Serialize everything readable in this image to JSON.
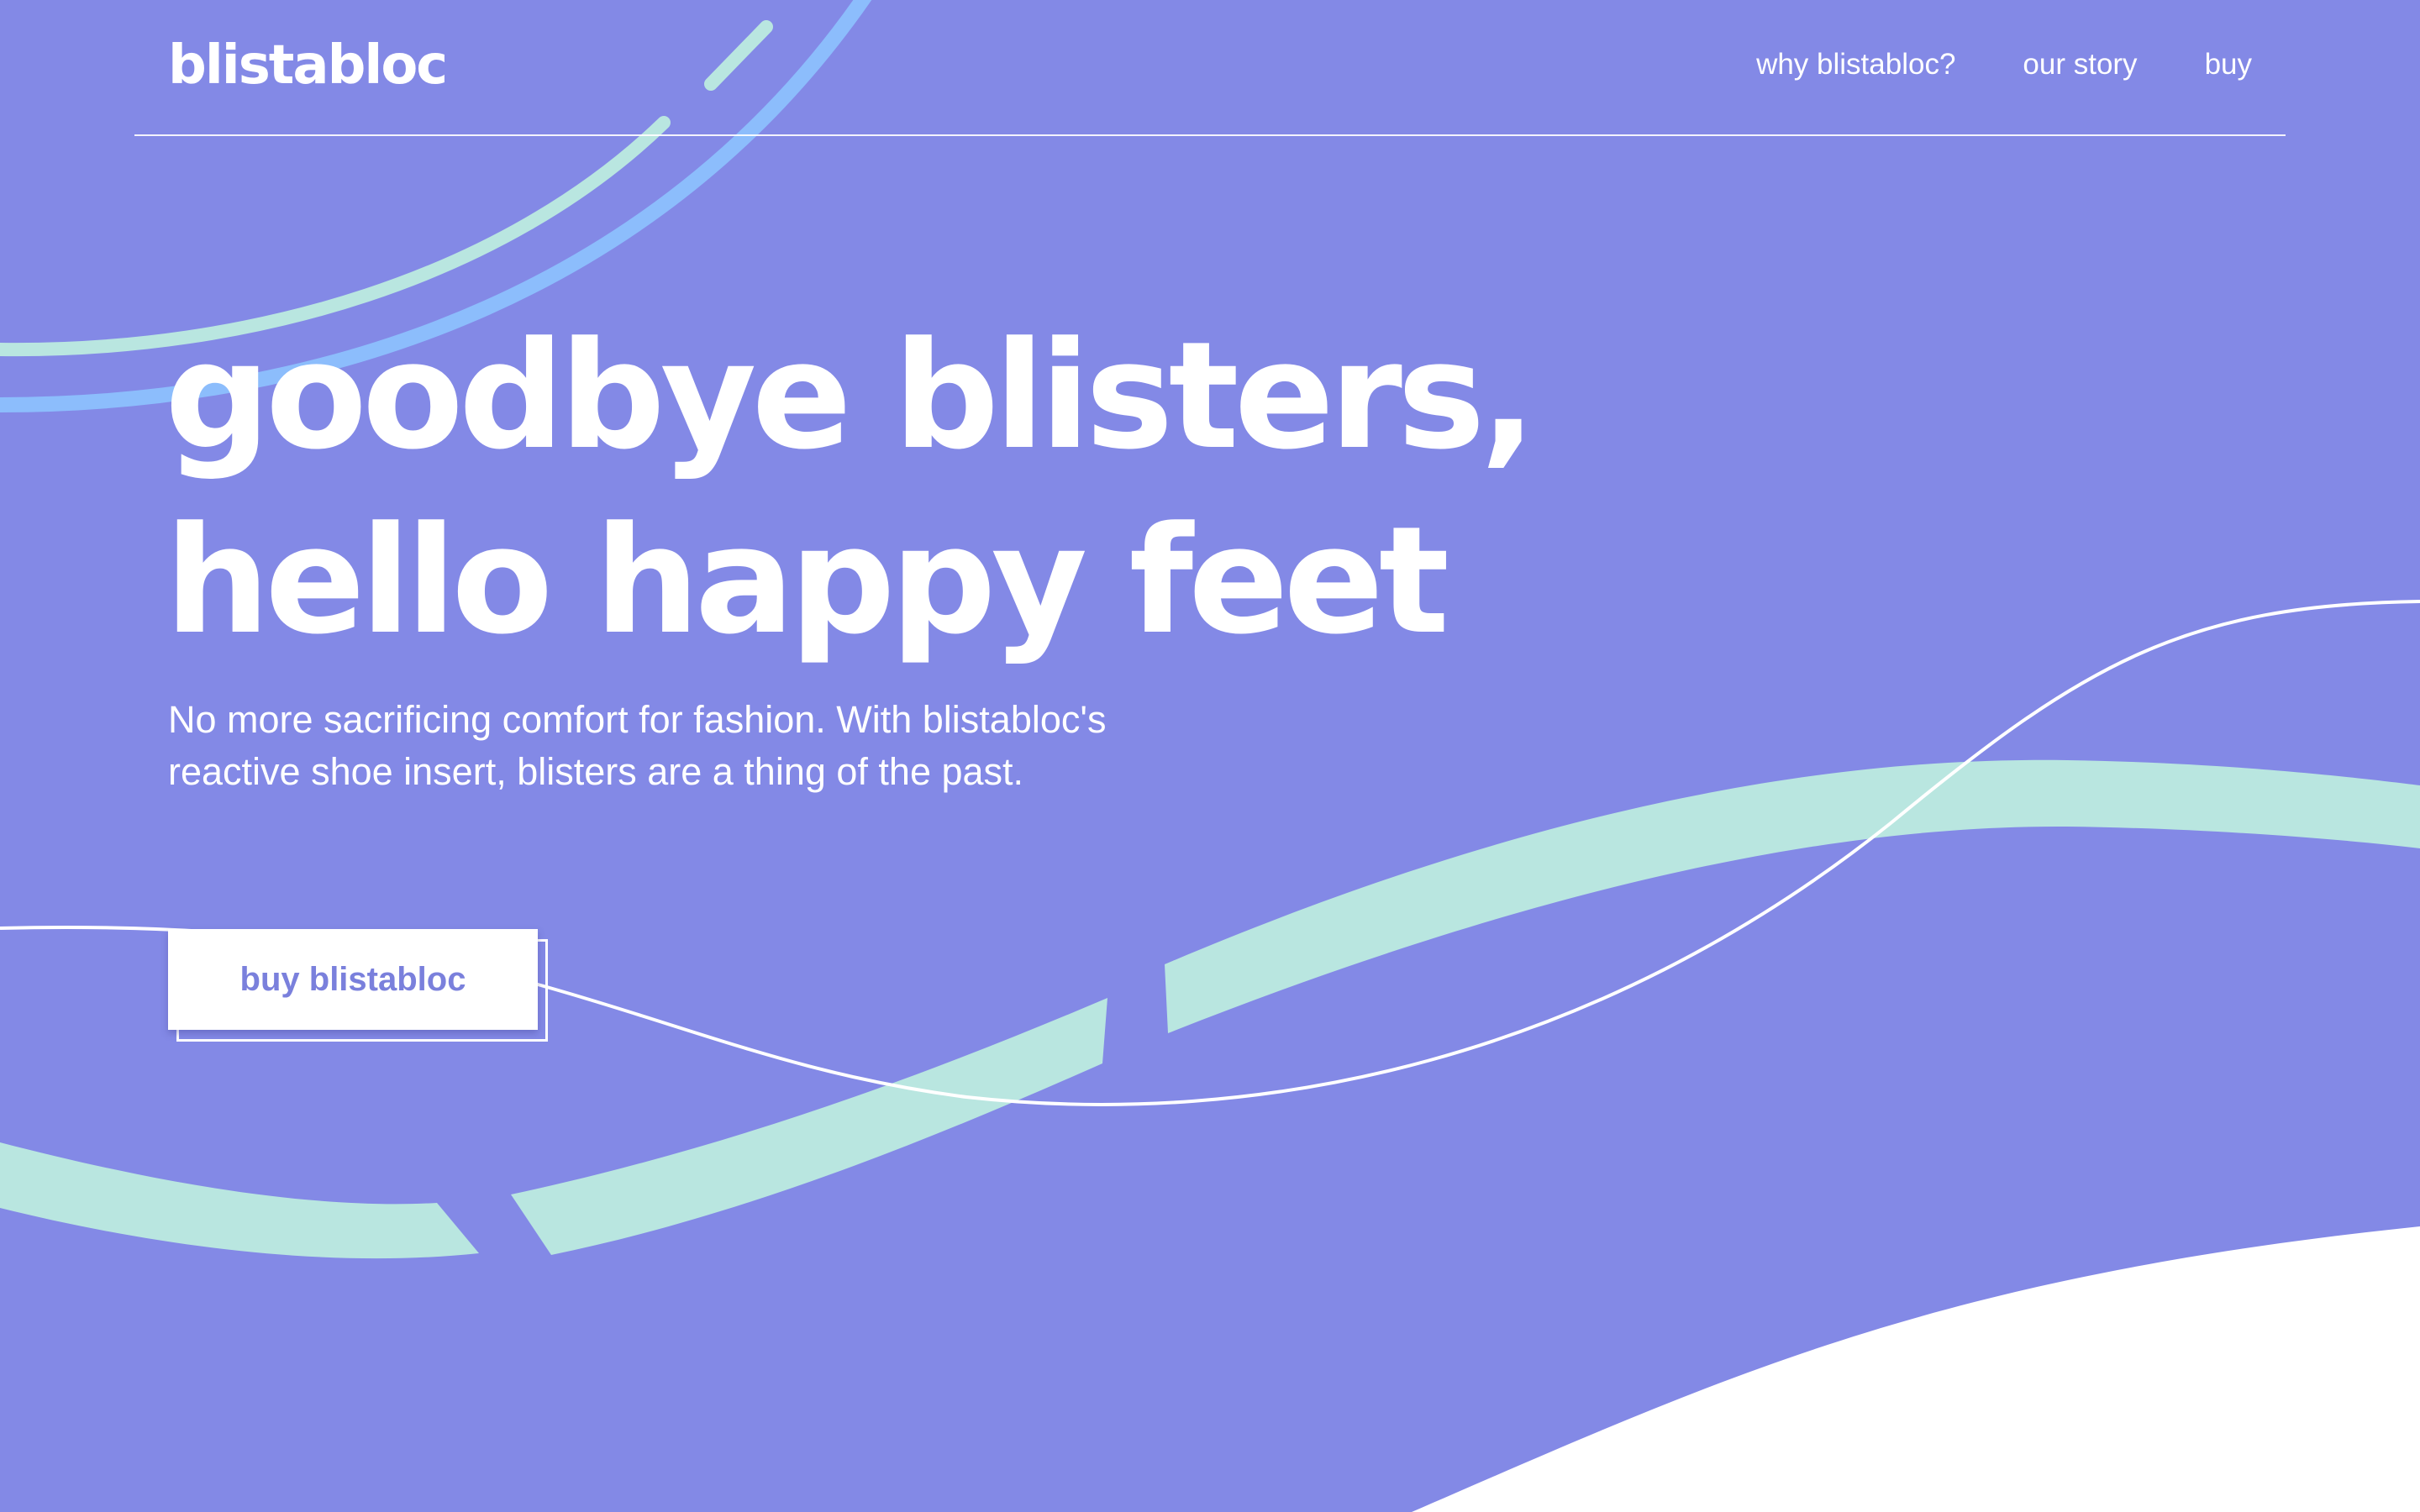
{
  "brand": {
    "logo_text": "blistabloc"
  },
  "nav": {
    "items": [
      {
        "label": "why blistabloc?"
      },
      {
        "label": "our story"
      },
      {
        "label": "buy"
      }
    ]
  },
  "hero": {
    "title_line_1": "goodbye blisters,",
    "title_line_2": "hello happy feet",
    "subtitle": "No more sacrificing comfort for fashion. With blistabloc's reactive shoe insert, blisters are a thing of the past.",
    "cta_label": "buy blistabloc"
  },
  "colors": {
    "background": "#8389e6",
    "mint": "#b9e6e0",
    "light_blue": "#8cbdfc",
    "white": "#ffffff",
    "cta_text": "#7a80dc"
  }
}
